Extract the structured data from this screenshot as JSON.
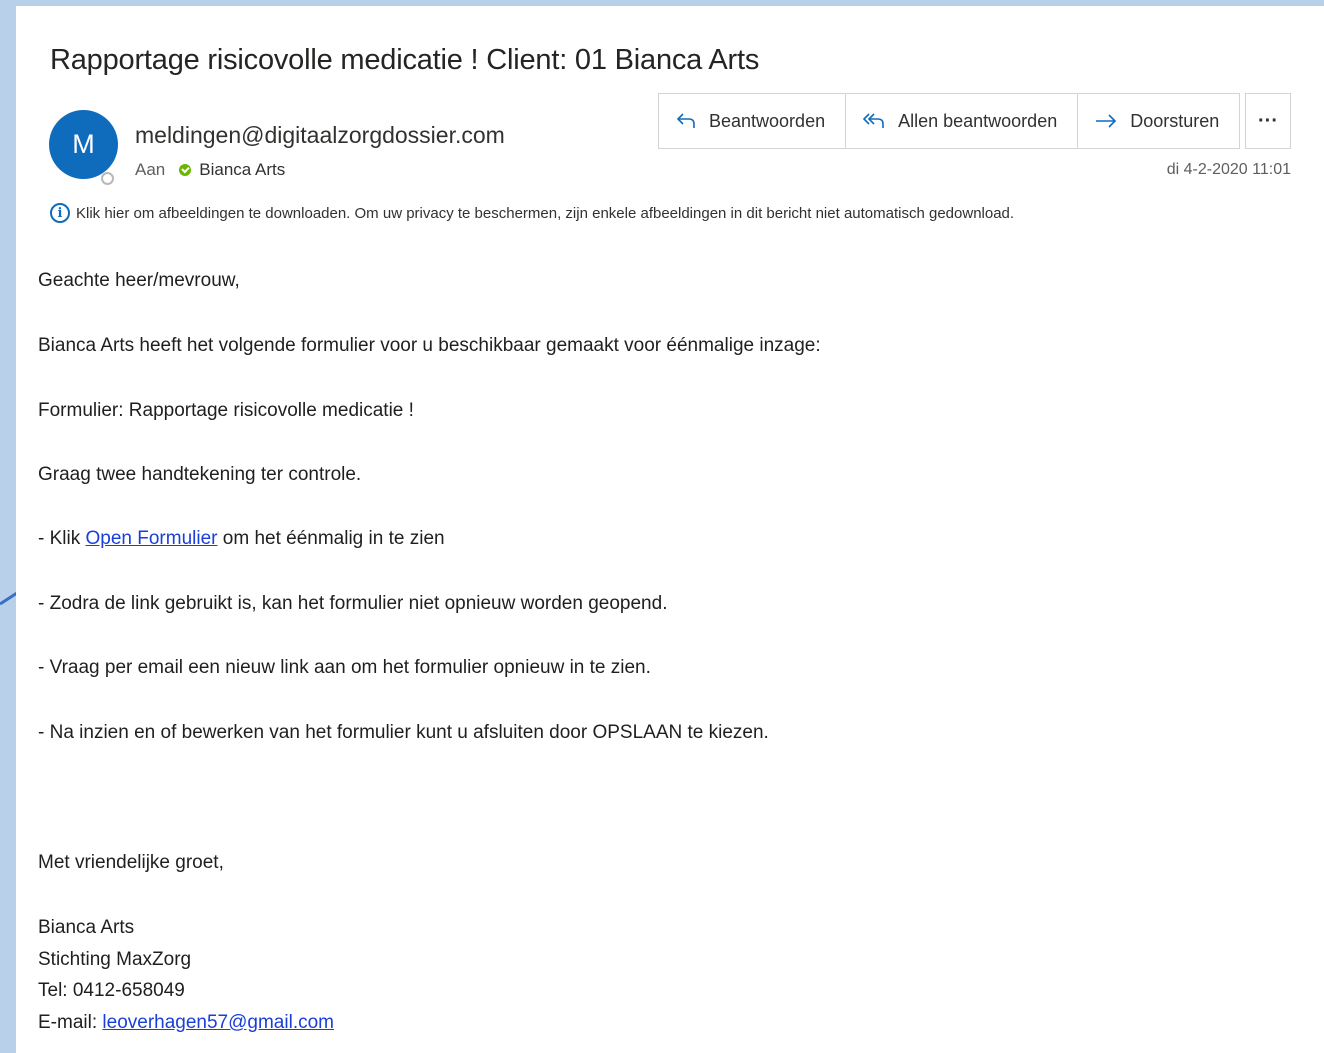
{
  "email": {
    "subject": "Rapportage risicovolle medicatie  ! Client: 01 Bianca Arts",
    "avatar_initial": "M",
    "sender": "meldingen@digitaalzorgdossier.com",
    "to_label": "Aan",
    "recipient": "Bianca Arts",
    "date": "di 4-2-2020 11:01",
    "info_notice": "Klik hier om afbeeldingen te downloaden. Om uw privacy te beschermen, zijn enkele afbeeldingen in dit bericht niet automatisch gedownload."
  },
  "actions": {
    "reply": "Beantwoorden",
    "reply_all": "Allen beantwoorden",
    "forward": "Doorsturen",
    "more": "···"
  },
  "body": {
    "greeting": "Geachte heer/mevrouw,",
    "line1": "Bianca Arts heeft het volgende formulier voor u beschikbaar gemaakt voor éénmalige inzage:",
    "line2": "Formulier: Rapportage risicovolle medicatie !",
    "line3": "Graag twee handtekening ter controle.",
    "line4_prefix": "- Klik ",
    "line4_link": "Open Formulier",
    "line4_suffix": " om het éénmalig in te zien",
    "line5": "- Zodra de link gebruikt is, kan het formulier niet opnieuw worden geopend.",
    "line6": "- Vraag per email een nieuw link aan om het formulier opnieuw in te zien.",
    "line7": "- Na inzien en of bewerken van het formulier kunt u afsluiten door OPSLAAN te kiezen.",
    "closing": "Met vriendelijke groet,",
    "sig_name": "Bianca Arts",
    "sig_org": "Stichting MaxZorg",
    "sig_tel": "Tel: 0412-658049",
    "sig_email_label": "E-mail: ",
    "sig_email": "leoverhagen57@gmail.com"
  },
  "colors": {
    "accent": "#0f6cbd",
    "link": "#1a3fd9",
    "presence": "#6bb700",
    "frame_background": "#b9d0ea",
    "annotation_arrow": "#3a6fc4"
  }
}
